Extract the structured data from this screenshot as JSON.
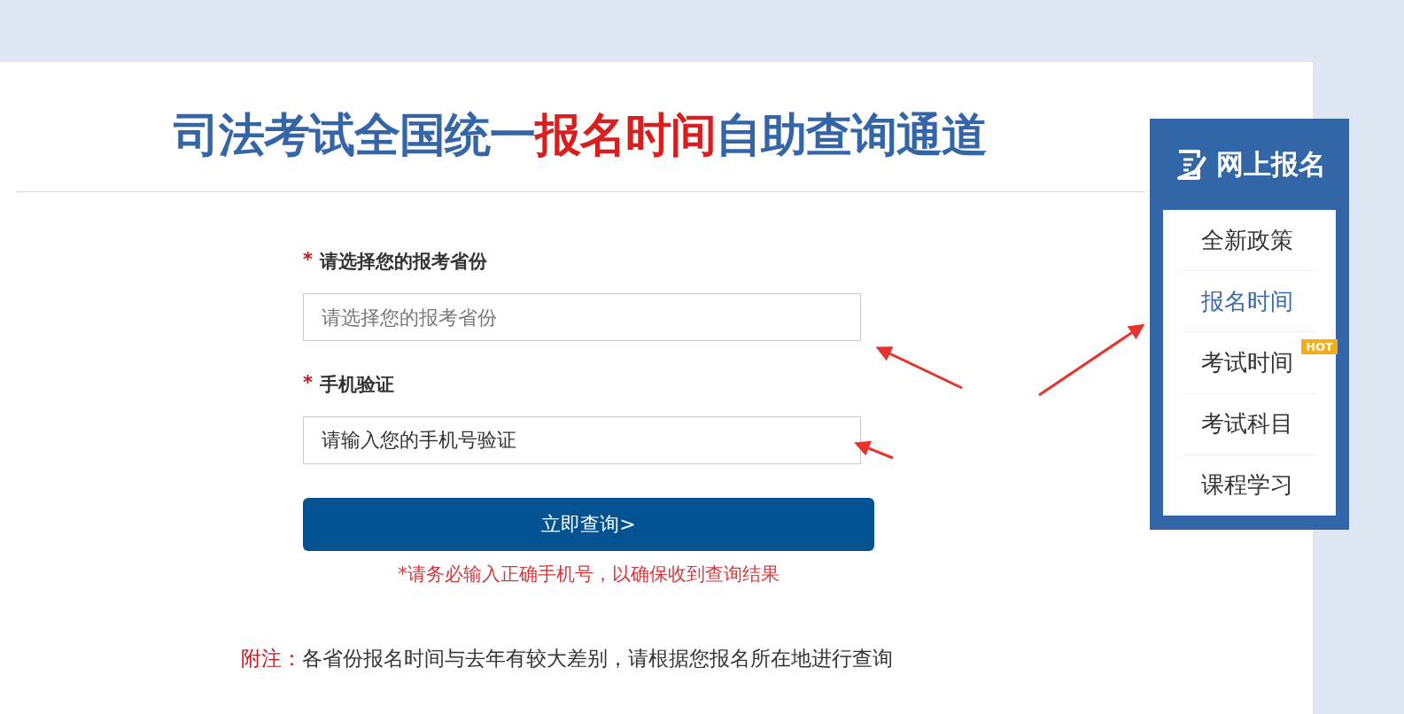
{
  "title": [
    {
      "text": "司法考试全国统一",
      "emphasis": false
    },
    {
      "text": "报名时间",
      "emphasis": true
    },
    {
      "text": "自助查询通道",
      "emphasis": false
    }
  ],
  "form": {
    "fields": [
      {
        "required_mark": "*",
        "label": "请选择您的报考省份",
        "placeholder": "请选择您的报考省份"
      },
      {
        "required_mark": "*",
        "label": "手机验证",
        "value": "请输入您的手机号验证"
      }
    ],
    "submit": "立即查询>",
    "warning": "*请务必输入正确手机号，以确保收到查询结果"
  },
  "footnote": {
    "label": "附注：",
    "text": "各省份报名时间与去年有较大差别，请根据您报名所在地进行查询"
  },
  "sidebar": {
    "title": "网上报名",
    "items": [
      {
        "label": "全新政策",
        "selected": false
      },
      {
        "label": "报名时间",
        "selected": true
      },
      {
        "label": "考试时间",
        "selected": false,
        "badge": "HOT"
      },
      {
        "label": "考试科目",
        "selected": false
      },
      {
        "label": "课程学习",
        "selected": false
      }
    ]
  }
}
